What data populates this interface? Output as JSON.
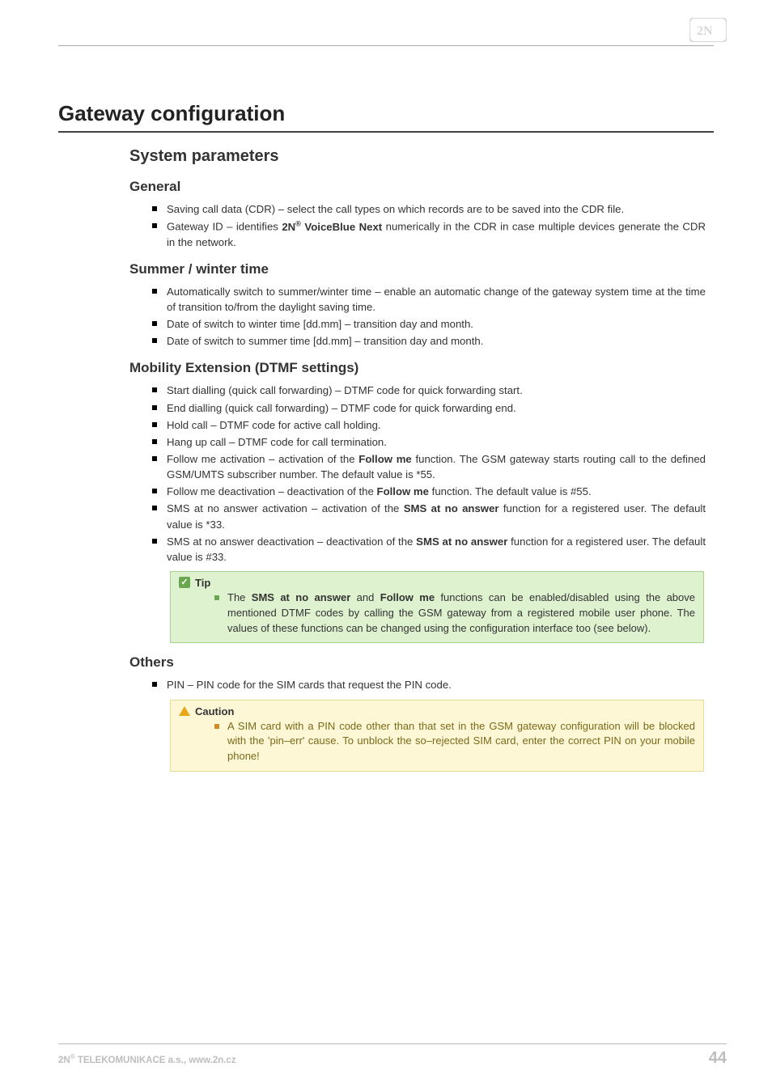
{
  "logo_alt": "2N",
  "title": "Gateway configuration",
  "sections": {
    "system_parameters": {
      "heading": "System parameters",
      "general": {
        "heading": "General",
        "items": [
          "Saving call data (CDR) – select the call types on which records are to be saved into the CDR file.",
          "Gateway ID – identifies <b>2N<span class=\"sup\">®</span> VoiceBlue Next</b> numerically in the CDR in case multiple devices generate the CDR in the network."
        ]
      },
      "summer_winter": {
        "heading": "Summer / winter time",
        "items": [
          "Automatically switch to summer/winter time – enable an automatic change of the gateway system time at the time of transition to/from the daylight saving time.",
          "Date of switch to winter time [dd.mm] – transition day and month.",
          "Date of switch to summer time [dd.mm] – transition day and month."
        ]
      },
      "mobility": {
        "heading": "Mobility Extension (DTMF settings)",
        "items": [
          "Start dialling (quick call forwarding) – DTMF code for quick forwarding start.",
          "End dialling (quick call forwarding) – DTMF code for quick forwarding end.",
          "Hold call – DTMF code for active call holding.",
          "Hang up call – DTMF code for call termination.",
          "Follow me activation – activation of the <b>Follow me</b> function. The GSM gateway starts routing call to the defined GSM/UMTS subscriber number. The default value is *55.",
          "Follow me deactivation – deactivation of the <b>Follow me</b> function. The default value is #55.",
          "SMS at no answer activation – activation of the <b>SMS at no answer</b> function for a registered user. The default value is *33.",
          "SMS at no answer deactivation – deactivation of the <b>SMS at no answer</b> function for a registered user. The default value is #33."
        ],
        "tip": {
          "label": "Tip",
          "text": "The <b>SMS at no answer</b> and <b>Follow me</b> functions can be enabled/disabled using the above mentioned DTMF codes by calling the GSM gateway from a registered mobile user phone. The values of these functions can be changed using the configuration interface too (see below)."
        }
      },
      "others": {
        "heading": "Others",
        "items": [
          "PIN – PIN code for the SIM cards that request the PIN code."
        ],
        "caution": {
          "label": "Caution",
          "text": "A SIM card with a PIN code other than that set in the GSM gateway configuration will be blocked with the 'pin–err' cause. To unblock the so–rejected SIM card, enter the correct PIN on your mobile phone!"
        }
      }
    }
  },
  "footer": {
    "left_prefix": "2N",
    "left_sup": "®",
    "left_rest": " TELEKOMUNIKACE a.s., www.2n.cz",
    "page": "44"
  }
}
